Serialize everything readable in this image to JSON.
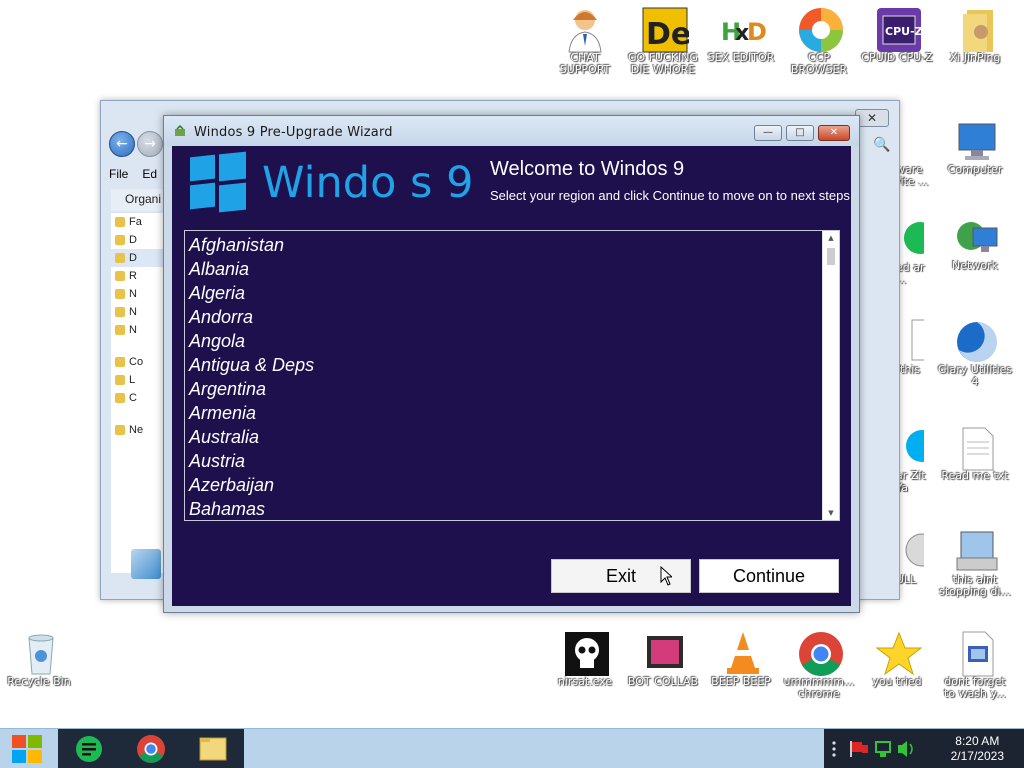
{
  "desktop": {
    "icons": [
      {
        "label": "CHAT SUPPORT"
      },
      {
        "label": "GO FUCKING DIE WHORE"
      },
      {
        "label": "SEX EDITOR"
      },
      {
        "label": "CCP BROWSER"
      },
      {
        "label": "CPUID CPU-Z"
      },
      {
        "label": "Xi JinPing"
      },
      {
        "label": "Computer"
      },
      {
        "label": "Network"
      },
      {
        "label": "Glary Utilities 4"
      },
      {
        "label": "Read me txt"
      },
      {
        "label": "this aint stopping di..."
      },
      {
        "label": "Recycle Bin"
      },
      {
        "label": "nirsat.exe"
      },
      {
        "label": "BOT COLLAB"
      },
      {
        "label": "BEEP BEEP"
      },
      {
        "label": "ummmmm... chrome"
      },
      {
        "label": "you tried"
      },
      {
        "label": "dont forget to wash y..."
      }
    ],
    "partial_labels": [
      "ware rite ...",
      "ed ar ...",
      "this",
      "ar Zit Ya",
      "ULL"
    ]
  },
  "explorer": {
    "menu": [
      "File",
      "Ed"
    ],
    "organize": "Organi",
    "nav_items": [
      "Fa",
      "D",
      "D",
      "R",
      "N",
      "N",
      "N",
      "Co",
      "L",
      "C",
      "Ne"
    ],
    "close_glyph": "✕",
    "search_glyph": "🔍"
  },
  "wizard": {
    "title": "Windos 9 Pre-Upgrade Wizard",
    "logo_text": "Windo    s 9",
    "welcome": "Welcome to Windos 9",
    "subtitle": "Select your region and click Continue to move on to next steps",
    "countries": [
      "Afghanistan",
      "Albania",
      "Algeria",
      "Andorra",
      "Angola",
      "Antigua & Deps",
      "Argentina",
      "Armenia",
      "Australia",
      "Austria",
      "Azerbaijan",
      "Bahamas"
    ],
    "exit_label": "Exit",
    "continue_label": "Continue",
    "accent": "#1fa3e6",
    "background": "#1e0f4d"
  },
  "taskbar": {
    "time": "8:20 AM",
    "date": "2/17/2023"
  }
}
